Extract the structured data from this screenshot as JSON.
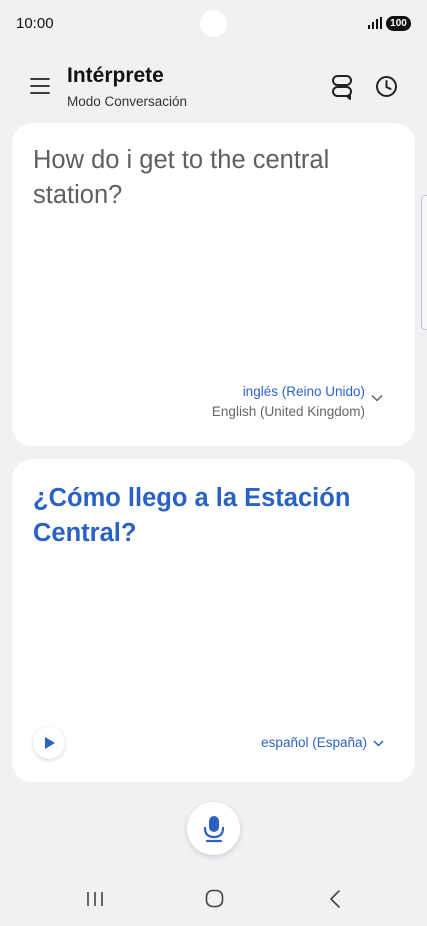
{
  "status_bar": {
    "time": "10:00",
    "battery": "100",
    "icons": [
      "signal-icon",
      "battery-icon"
    ]
  },
  "header": {
    "title": "Intérprete",
    "subtitle": "Modo Conversación",
    "icons": [
      "menu-icon",
      "conversation-icon",
      "history-icon"
    ]
  },
  "source_card": {
    "text": "How do i get to the central station?",
    "language_native": "inglés (Reino Unido)",
    "language_english": "English (United Kingdom)"
  },
  "target_card": {
    "text": "¿Cómo llego a la Estación Central?",
    "language": "español (España)"
  },
  "colors": {
    "accent": "#2a62c4",
    "background": "#f1f1f4",
    "card": "#ffffff"
  },
  "nav": [
    "recents-icon",
    "home-icon",
    "back-icon"
  ]
}
